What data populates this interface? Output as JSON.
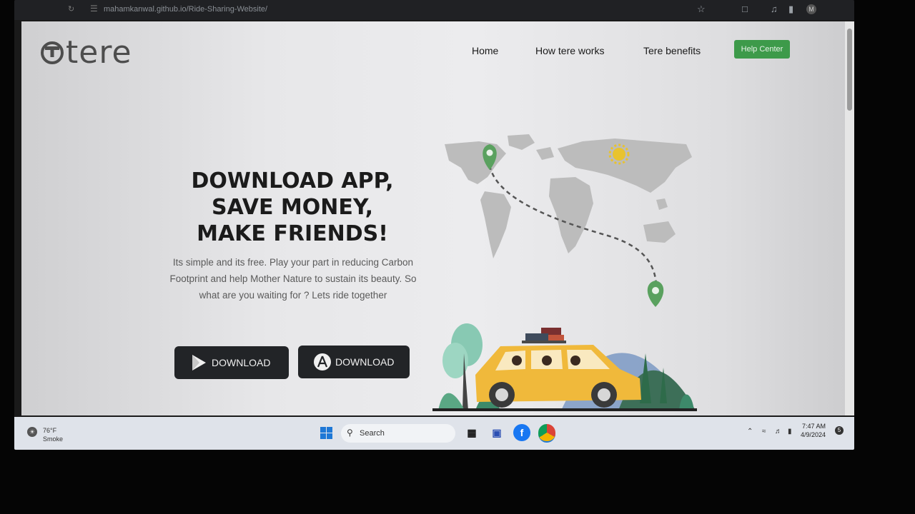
{
  "browser": {
    "url": "mahamkanwal.github.io/Ride-Sharing-Website/",
    "profile_initial": "M"
  },
  "site": {
    "logo_text": "tere",
    "nav": [
      "Home",
      "How tere works",
      "Tere benefits"
    ],
    "help_label": "Help Center"
  },
  "hero": {
    "title_lines": [
      "DOWNLOAD APP,",
      "SAVE MONEY,",
      "MAKE FRIENDS!"
    ],
    "subtitle": "Its simple and its free. Play your part in reducing Carbon Footprint and help Mother Nature to sustain its beauty. So what are you waiting for ? Lets ride together",
    "download_play_label": "DOWNLOAD",
    "download_appstore_label": "DOWNLOAD"
  },
  "taskbar": {
    "weather_temp": "76°F",
    "weather_condition": "Smoke",
    "search_label": "Search",
    "time": "7:47 AM",
    "date": "4/9/2024",
    "notification_count": "5"
  },
  "colors": {
    "accent_green": "#3d9a4a",
    "car_yellow": "#f0b93b",
    "button_dark": "#222427"
  },
  "icons": [
    "reload-icon",
    "site-settings-icon",
    "star-icon",
    "extensions-icon",
    "media-icon",
    "sidebar-icon",
    "google-play-icon",
    "app-store-icon",
    "windows-start-icon",
    "search-icon",
    "file-explorer-icon",
    "chat-icon",
    "facebook-icon",
    "chrome-icon",
    "chevron-up-icon",
    "wifi-icon",
    "volume-icon",
    "battery-icon"
  ]
}
